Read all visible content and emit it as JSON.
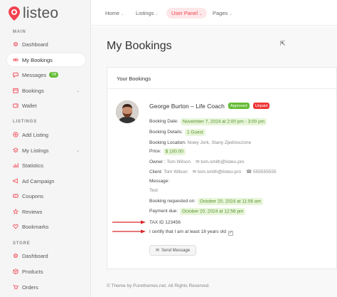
{
  "brand": {
    "name": "listeo",
    "accent": "#f1424f"
  },
  "sidebar": {
    "sections": [
      {
        "title": "MAIN"
      },
      {
        "title": "LISTINGS"
      },
      {
        "title": "STORE"
      }
    ],
    "items": [
      {
        "label": "Dashboard",
        "icon": "gear-icon"
      },
      {
        "label": "My Bookings",
        "icon": "link-icon",
        "active": true
      },
      {
        "label": "Messages",
        "icon": "chat-icon",
        "badge": "7/8"
      },
      {
        "label": "Bookings",
        "icon": "calendar-icon",
        "has_submenu": true
      },
      {
        "label": "Wallet",
        "icon": "wallet-icon"
      },
      {
        "label": "Add Listing",
        "icon": "plus-circle-icon"
      },
      {
        "label": "My Listings",
        "icon": "layers-icon",
        "has_submenu": true
      },
      {
        "label": "Statistics",
        "icon": "chart-icon"
      },
      {
        "label": "Ad Campaign",
        "icon": "megaphone-icon"
      },
      {
        "label": "Coupons",
        "icon": "coupon-icon"
      },
      {
        "label": "Reviews",
        "icon": "star-icon"
      },
      {
        "label": "Bookmarks",
        "icon": "heart-icon"
      },
      {
        "label": "Dashboard",
        "icon": "gear-icon"
      },
      {
        "label": "Products",
        "icon": "box-icon"
      },
      {
        "label": "Orders",
        "icon": "cart-icon"
      }
    ]
  },
  "topnav": [
    {
      "label": "Home"
    },
    {
      "label": "Listings"
    },
    {
      "label": "User Panel",
      "active": true
    },
    {
      "label": "Pages"
    }
  ],
  "page_title": "My Bookings",
  "card": {
    "title": "Your Bookings",
    "booking": {
      "name": "George Burton – Life Coach",
      "status_approved": "Approved",
      "status_unpaid": "Unpaid",
      "booking_date_label": "Booking Date:",
      "booking_date": "November 7, 2024 at 2:00 pm - 3:00 pm",
      "booking_details_label": "Booking Details:",
      "booking_details": "1 Guest",
      "booking_location_label": "Booking Location:",
      "booking_location": "Nowy Jork, Stany Zjednoczone",
      "price_label": "Price:",
      "price": "$ 100.00",
      "owner_label": "Owner :",
      "owner_name": "Tom Wilson",
      "owner_email": "tom.smith@listeo.pro",
      "client_label": "Client:",
      "client_name": "Tom Wilson",
      "client_email": "tom.smith@listeo.pro",
      "client_phone": "555555555",
      "message_label": "Message:",
      "message": "Test",
      "requested_label": "Booking requested on:",
      "requested_on": "October 20, 2024 at 11:56 am",
      "payment_due_label": "Payment due:",
      "payment_due": "October 20, 2024 at 12:56 pm",
      "tax_id": "TAX ID 123456",
      "certify_text": "I certify that I am at least 18 years old",
      "certify_checked": true,
      "send_message": "Send Message"
    }
  },
  "footer": "© Theme by Purethemes.net. All Rights Reserved."
}
